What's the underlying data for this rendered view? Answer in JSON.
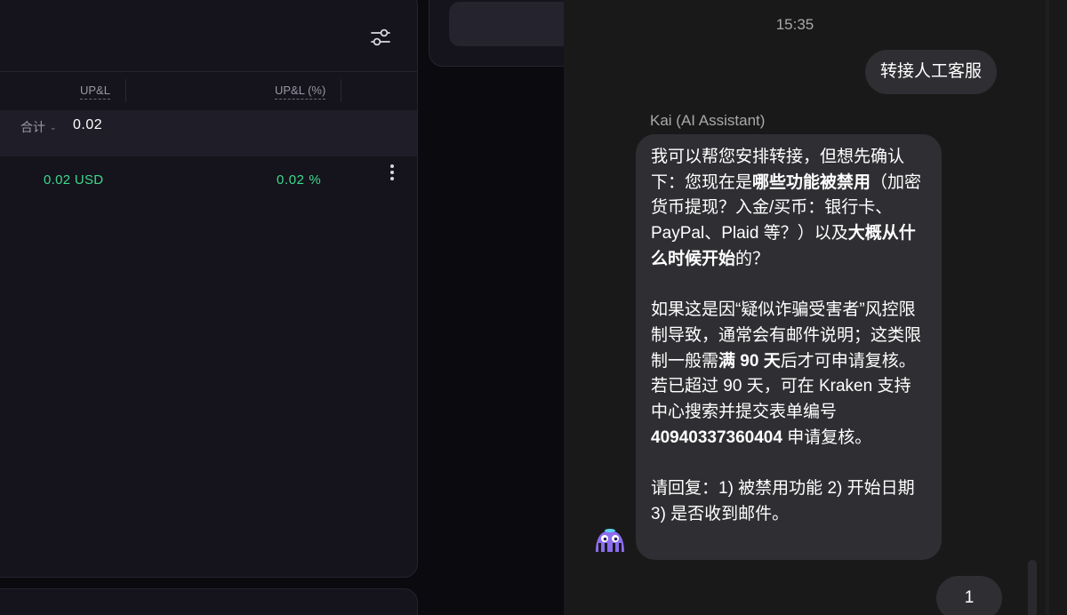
{
  "positions": {
    "columns": {
      "upl": "UP&L",
      "upl_pct": "UP&L (%)"
    },
    "total": {
      "label": "合计",
      "value": "0.02"
    },
    "row": {
      "upl": "0.02 USD",
      "upl_pct": "0.02 %"
    }
  },
  "chat": {
    "time": "15:35",
    "user_message_1": "转接人工客服",
    "assistant_name": "Kai (AI Assistant)",
    "assistant_message": {
      "p1_a": "我可以帮您安排转接，但想先确认下：您现在是",
      "p1_b": "哪些功能被禁用",
      "p1_c": "（加密货币提现？入金/买币：银行卡、PayPal、Plaid 等？）以及",
      "p1_d": "大概从什么时候开始",
      "p1_e": "的？",
      "p2_a": "如果这是因“疑似诈骗受害者”风控限制导致，通常会有邮件说明；这类限制一般需",
      "p2_b": "满 90 天",
      "p2_c": "后才可申请复核。若已超过 90 天，可在 Kraken 支持中心搜索并提交表单编号 ",
      "p2_d": "40940337360404",
      "p2_e": " 申请复核。",
      "p3": "请回复：1) 被禁用功能 2) 开始日期 3) 是否收到邮件。"
    },
    "user_message_2": "1"
  },
  "colors": {
    "positive": "#3fd98c",
    "bubble": "#2f2f33",
    "chat_bg": "#191919",
    "panel_bg": "#15131c"
  }
}
